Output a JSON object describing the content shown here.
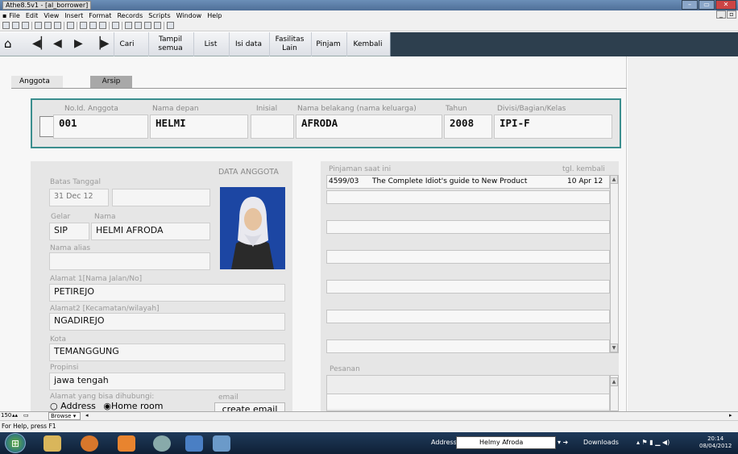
{
  "window": {
    "title": "Athe8.5v1 - [al_borrower]"
  },
  "menu": [
    "File",
    "Edit",
    "View",
    "Insert",
    "Format",
    "Records",
    "Scripts",
    "Window",
    "Help"
  ],
  "nav": {
    "cari": "Cari",
    "tampil_semua": [
      "Tampil",
      "semua"
    ],
    "list": "List",
    "isi_data": "Isi data",
    "fasilitas_lain": [
      "Fasilitas",
      "Lain"
    ],
    "pinjam": "Pinjam",
    "kembali": "Kembali"
  },
  "tabs": {
    "anggota": "Anggota",
    "arsip": "Arsip"
  },
  "header": {
    "no_id_label": "No.Id. Anggota",
    "no_id": "001",
    "nama_depan_label": "Nama depan",
    "nama_depan": "HELMI",
    "inisial_label": "Inisial",
    "inisial": "",
    "nama_belakang_label": "Nama belakang (nama keluarga)",
    "nama_belakang": "AFRODA",
    "tahun_label": "Tahun",
    "tahun": "2008",
    "divisi_label": "Divisi/Bagian/Kelas",
    "divisi": "IPI-F"
  },
  "member": {
    "section_title": "DATA ANGGOTA",
    "batas_tanggal_label": "Batas Tanggal",
    "batas_tanggal": "31 Dec 12",
    "batas_tanggal2": "",
    "gelar_label": "Gelar",
    "gelar": "SIP",
    "nama_label": "Nama",
    "nama": "HELMI AFRODA",
    "nama_alias_label": "Nama alias",
    "nama_alias": "",
    "alamat1_label": "Alamat 1[Nama Jalan/No]",
    "alamat1": "PETIREJO",
    "alamat2_label": "Alamat2 [Kecamatan/wilayah]",
    "alamat2": "NGADIREJO",
    "kota_label": "Kota",
    "kota": "TEMANGGUNG",
    "propinsi_label": "Propinsi",
    "propinsi": "jawa tengah",
    "alamat_hubungi_label": "Alamat  yang bisa dihubungi:",
    "email_label": "email",
    "radio_address": "Address",
    "radio_home": "Home room",
    "create_email": "create email"
  },
  "loans": {
    "title": "Pinjaman saat ini",
    "tgl_kembali_label": "tgl. kembali",
    "rows": [
      {
        "code": "4599/03",
        "title": "The Complete Idiot's guide to New Product",
        "date": "10 Apr 12"
      }
    ],
    "pesanan_label": "Pesanan"
  },
  "status": {
    "zoom": "150",
    "mode": "Browse",
    "help": "For Help, press F1"
  },
  "taskbar": {
    "address_label": "Address",
    "address_value": "Helmy Afroda",
    "downloads": "Downloads",
    "time": "20:14",
    "date": "08/04/2012"
  }
}
